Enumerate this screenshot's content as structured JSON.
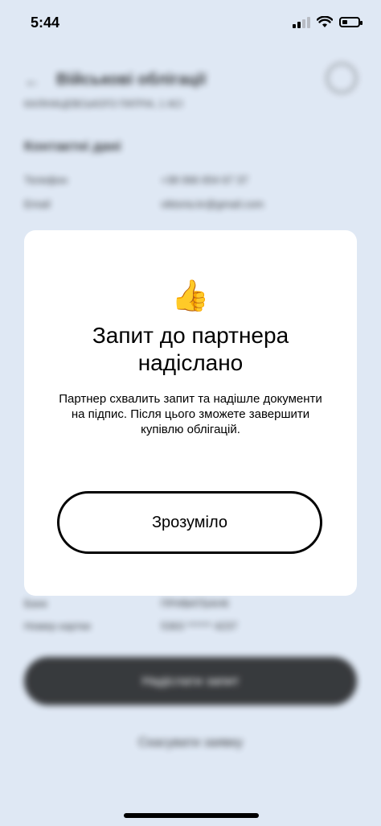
{
  "status_bar": {
    "time": "5:44"
  },
  "background": {
    "back": "←",
    "title": "Військові облігації",
    "subtitle": "КАЛІНАЦЕВСЬКОГО ПАТРІА, 1 АСІ",
    "contacts_title": "Контактні дані",
    "rows": [
      {
        "label": "Телефон",
        "value": "+38 066 654 67 37"
      },
      {
        "label": "Email",
        "value": "viktoria.kr@gmail.com"
      }
    ],
    "rows2": [
      {
        "label": "Банк",
        "value": "ПРИВАТБАНК"
      },
      {
        "label": "Номер картки",
        "value": "5363 ****** 4237"
      }
    ],
    "primary_button": "Надіслати запит",
    "secondary_button": "Скасувати заявку"
  },
  "modal": {
    "emoji": "👍",
    "title": "Запит до партнера надіслано",
    "text": "Партнер схвалить запит та надішле документи на підпис. Після цього зможете завершити купівлю облігацій.",
    "button": "Зрозуміло"
  }
}
